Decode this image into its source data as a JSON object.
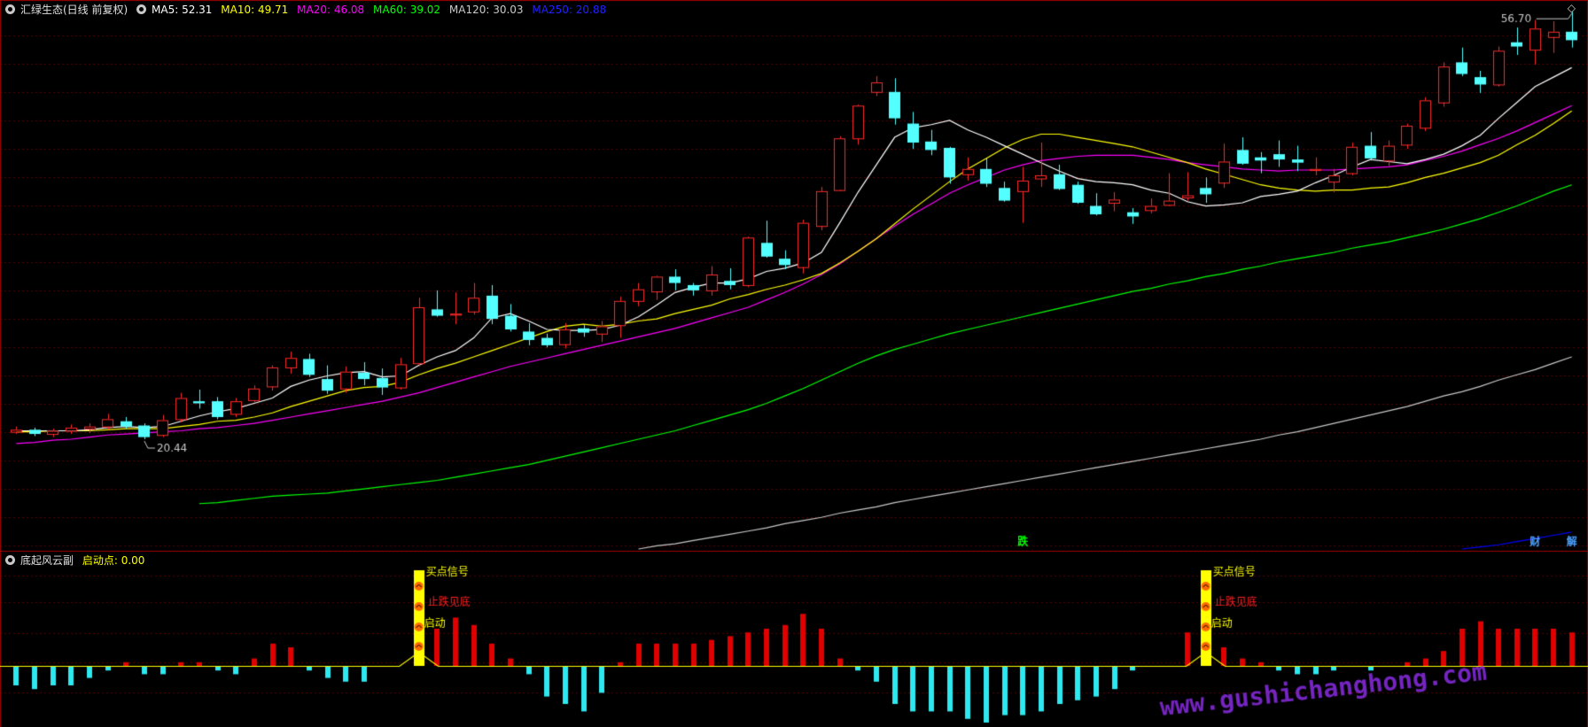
{
  "main_legend": {
    "title": "汇绿生态(日线 前复权)",
    "ma": [
      {
        "label": "MA5: 52.31",
        "color": "#ffffff"
      },
      {
        "label": "MA10: 49.71",
        "color": "#ffff00"
      },
      {
        "label": "MA20: 46.08",
        "color": "#ff00ff"
      },
      {
        "label": "MA60: 39.02",
        "color": "#00ff00"
      },
      {
        "label": "MA120: 30.03",
        "color": "#c8c8c8"
      },
      {
        "label": "MA250: 20.88",
        "color": "#0000ff"
      }
    ]
  },
  "sub_legend": {
    "title": "底起风云副",
    "value": "启动点: 0.00"
  },
  "annotations": {
    "high": "56.70",
    "low": "20.44",
    "markers": [
      "跌",
      "财",
      "解"
    ],
    "signal1": "买点信号",
    "signal2": "止跌见底",
    "signal3": "启动"
  },
  "watermark": "www.gushichanghong.com",
  "colors": {
    "up": "#ff2a2a",
    "down": "#54ffff",
    "grid": "#5a0000",
    "ma5": "#ffffff",
    "ma10": "#ffff00",
    "ma20": "#ff00ff",
    "ma60": "#00ff00",
    "ma120": "#c8c8c8",
    "ma250": "#0000ff",
    "signal": "#ffff00",
    "watermark": "#8a2be2"
  },
  "chart_data": {
    "type": "candlestick",
    "ohlc": [
      [
        21.1,
        21.6,
        20.9,
        21.3
      ],
      [
        21.3,
        21.5,
        20.7,
        20.9
      ],
      [
        20.9,
        21.4,
        20.6,
        21.2
      ],
      [
        21.2,
        21.8,
        20.9,
        21.5
      ],
      [
        21.4,
        21.9,
        21.0,
        21.6
      ],
      [
        21.6,
        22.8,
        21.3,
        22.3
      ],
      [
        22.1,
        22.5,
        21.4,
        21.6
      ],
      [
        21.7,
        21.9,
        20.4,
        20.6
      ],
      [
        20.8,
        22.7,
        20.6,
        22.2
      ],
      [
        22.3,
        24.8,
        22.0,
        24.3
      ],
      [
        24.0,
        25.1,
        23.3,
        23.8
      ],
      [
        24.0,
        24.4,
        22.3,
        22.5
      ],
      [
        22.8,
        24.3,
        22.5,
        24.0
      ],
      [
        24.1,
        25.5,
        23.9,
        25.2
      ],
      [
        25.4,
        27.4,
        25.0,
        27.2
      ],
      [
        27.2,
        28.7,
        26.6,
        28.1
      ],
      [
        28.0,
        28.5,
        26.3,
        26.5
      ],
      [
        26.1,
        27.4,
        24.7,
        25.0
      ],
      [
        25.2,
        27.3,
        24.8,
        26.8
      ],
      [
        26.7,
        27.7,
        25.5,
        26.1
      ],
      [
        26.2,
        27.1,
        24.6,
        25.3
      ],
      [
        25.3,
        28.1,
        25.1,
        27.5
      ],
      [
        27.6,
        33.8,
        27.3,
        32.9
      ],
      [
        32.7,
        34.5,
        32.0,
        32.1
      ],
      [
        32.2,
        34.3,
        31.3,
        32.3
      ],
      [
        32.5,
        35.2,
        32.2,
        33.8
      ],
      [
        34.0,
        35.0,
        31.3,
        31.8
      ],
      [
        32.1,
        33.2,
        30.6,
        30.8
      ],
      [
        30.6,
        31.4,
        29.3,
        29.8
      ],
      [
        30.0,
        30.4,
        29.1,
        29.3
      ],
      [
        29.4,
        31.4,
        29.0,
        30.8
      ],
      [
        30.9,
        31.3,
        30.1,
        30.5
      ],
      [
        30.4,
        31.6,
        29.6,
        31.1
      ],
      [
        31.2,
        33.9,
        30.0,
        33.5
      ],
      [
        33.5,
        35.2,
        33.0,
        34.6
      ],
      [
        34.4,
        35.9,
        33.6,
        35.8
      ],
      [
        35.8,
        36.5,
        34.5,
        35.2
      ],
      [
        35.0,
        35.2,
        34.0,
        34.5
      ],
      [
        34.5,
        36.8,
        34.0,
        36.0
      ],
      [
        35.4,
        36.6,
        34.6,
        35.0
      ],
      [
        35.0,
        39.6,
        34.8,
        39.5
      ],
      [
        39.0,
        41.1,
        37.6,
        37.7
      ],
      [
        37.5,
        38.3,
        36.5,
        36.9
      ],
      [
        36.7,
        41.2,
        36.1,
        40.9
      ],
      [
        40.6,
        44.3,
        40.2,
        43.9
      ],
      [
        44.0,
        49.1,
        43.9,
        48.9
      ],
      [
        48.9,
        52.1,
        48.3,
        52.0
      ],
      [
        53.3,
        54.8,
        52.9,
        54.2
      ],
      [
        53.3,
        54.6,
        50.2,
        50.8
      ],
      [
        50.3,
        51.4,
        47.9,
        48.5
      ],
      [
        48.6,
        49.7,
        47.3,
        47.8
      ],
      [
        48.0,
        48.1,
        44.6,
        45.2
      ],
      [
        45.5,
        47.1,
        44.9,
        46.0
      ],
      [
        46.0,
        47.0,
        44.3,
        44.6
      ],
      [
        44.2,
        44.8,
        42.9,
        43.0
      ],
      [
        43.9,
        46.2,
        40.9,
        44.9
      ],
      [
        45.1,
        48.5,
        44.3,
        45.4
      ],
      [
        45.5,
        46.4,
        44.0,
        44.1
      ],
      [
        44.5,
        44.8,
        42.7,
        42.8
      ],
      [
        42.5,
        43.7,
        41.6,
        41.7
      ],
      [
        42.8,
        43.8,
        42.0,
        43.1
      ],
      [
        41.9,
        42.3,
        40.8,
        41.5
      ],
      [
        42.1,
        43.2,
        41.8,
        42.5
      ],
      [
        42.6,
        45.6,
        42.5,
        43.0
      ],
      [
        43.3,
        45.7,
        43.0,
        43.5
      ],
      [
        44.2,
        45.2,
        42.8,
        43.6
      ],
      [
        44.7,
        48.4,
        44.2,
        46.7
      ],
      [
        47.8,
        49.0,
        46.4,
        46.5
      ],
      [
        47.1,
        47.6,
        45.6,
        46.8
      ],
      [
        47.4,
        48.7,
        46.2,
        46.9
      ],
      [
        46.9,
        48.2,
        45.8,
        46.6
      ],
      [
        45.9,
        47.1,
        45.4,
        46.0
      ],
      [
        44.8,
        46.0,
        43.8,
        45.4
      ],
      [
        45.6,
        48.5,
        45.4,
        48.1
      ],
      [
        48.2,
        49.5,
        46.8,
        47.0
      ],
      [
        46.8,
        48.7,
        46.3,
        48.2
      ],
      [
        48.3,
        50.3,
        47.9,
        50.1
      ],
      [
        49.9,
        52.8,
        49.6,
        52.5
      ],
      [
        52.3,
        56.1,
        51.9,
        55.7
      ],
      [
        56.1,
        57.5,
        54.8,
        55.0
      ],
      [
        54.7,
        55.3,
        53.2,
        54.0
      ],
      [
        54.0,
        57.6,
        53.8,
        57.2
      ],
      [
        58.0,
        59.4,
        56.8,
        57.6
      ],
      [
        57.3,
        60.1,
        55.9,
        59.3
      ],
      [
        58.5,
        60.0,
        57.0,
        59.0
      ],
      [
        59.0,
        60.9,
        57.5,
        58.2
      ]
    ],
    "ma5": [
      21.2,
      21.2,
      21.2,
      21.2,
      21.3,
      21.5,
      21.6,
      21.5,
      21.6,
      22.1,
      22.6,
      23.0,
      23.3,
      23.8,
      24.3,
      25.4,
      26.0,
      26.4,
      26.7,
      26.8,
      26.3,
      26.4,
      27.4,
      28.2,
      28.8,
      30.0,
      31.9,
      32.3,
      31.6,
      30.8,
      30.7,
      30.7,
      30.8,
      31.2,
      32.0,
      33.1,
      34.3,
      34.8,
      35.2,
      35.2,
      35.6,
      36.3,
      36.6,
      37.1,
      38.1,
      40.9,
      43.8,
      46.4,
      49.0,
      49.9,
      50.2,
      50.6,
      49.7,
      49.0,
      48.2,
      47.4,
      46.6,
      45.8,
      45.1,
      44.8,
      44.7,
      44.5,
      44.0,
      43.7,
      42.9,
      42.5,
      42.6,
      42.8,
      43.4,
      43.6,
      43.9,
      44.7,
      45.4,
      46.2,
      46.9,
      46.7,
      46.5,
      46.9,
      47.4,
      48.2,
      49.2,
      50.8,
      52.3,
      53.8,
      54.7,
      55.6
    ],
    "ma10": [
      21.1,
      21.1,
      21.2,
      21.2,
      21.2,
      21.3,
      21.4,
      21.4,
      21.4,
      21.6,
      21.8,
      22.1,
      22.2,
      22.5,
      22.9,
      23.5,
      24.0,
      24.5,
      25.0,
      25.3,
      25.4,
      25.8,
      26.5,
      27.1,
      27.6,
      28.2,
      28.8,
      29.4,
      30.0,
      30.6,
      31.1,
      31.3,
      31.1,
      31.3,
      31.6,
      31.8,
      32.3,
      32.7,
      33.1,
      33.7,
      34.1,
      34.6,
      35.0,
      35.5,
      36.1,
      37.1,
      38.2,
      39.4,
      40.8,
      42.2,
      43.5,
      44.8,
      46.0,
      47.0,
      48.0,
      48.8,
      49.3,
      49.3,
      49.0,
      48.7,
      48.4,
      48.1,
      47.6,
      47.1,
      46.6,
      46.0,
      45.5,
      45.0,
      44.5,
      44.2,
      44.0,
      43.9,
      44.0,
      44.0,
      44.2,
      44.3,
      44.7,
      45.2,
      45.6,
      46.1,
      46.6,
      47.3,
      48.3,
      49.2,
      50.3,
      51.5
    ],
    "ma20": [
      20.0,
      20.1,
      20.3,
      20.4,
      20.6,
      20.8,
      20.9,
      21.0,
      21.1,
      21.2,
      21.4,
      21.5,
      21.7,
      21.9,
      22.2,
      22.5,
      22.8,
      23.1,
      23.4,
      23.7,
      24.0,
      24.4,
      24.8,
      25.3,
      25.8,
      26.3,
      26.8,
      27.3,
      27.7,
      28.1,
      28.5,
      28.9,
      29.3,
      29.7,
      30.1,
      30.5,
      30.9,
      31.4,
      31.9,
      32.4,
      32.9,
      33.6,
      34.3,
      35.1,
      36.0,
      37.0,
      38.2,
      39.4,
      40.6,
      41.7,
      42.7,
      43.7,
      44.5,
      45.2,
      45.9,
      46.4,
      46.8,
      47.0,
      47.2,
      47.3,
      47.3,
      47.3,
      47.1,
      46.9,
      46.6,
      46.4,
      46.2,
      46.0,
      45.9,
      45.8,
      45.9,
      45.9,
      45.9,
      46.0,
      46.1,
      46.2,
      46.4,
      46.8,
      47.2,
      47.7,
      48.3,
      48.9,
      49.6,
      50.4,
      51.2,
      52.0
    ],
    "ma60": [
      null,
      null,
      null,
      null,
      null,
      null,
      null,
      null,
      null,
      null,
      14.3,
      14.4,
      14.6,
      14.8,
      15.0,
      15.1,
      15.2,
      15.3,
      15.5,
      15.7,
      15.9,
      16.1,
      16.3,
      16.5,
      16.8,
      17.1,
      17.4,
      17.7,
      18.0,
      18.4,
      18.8,
      19.2,
      19.6,
      20.0,
      20.4,
      20.8,
      21.2,
      21.7,
      22.2,
      22.7,
      23.2,
      23.8,
      24.5,
      25.2,
      26.0,
      26.8,
      27.6,
      28.3,
      28.9,
      29.4,
      29.9,
      30.4,
      30.8,
      31.2,
      31.6,
      32.0,
      32.4,
      32.8,
      33.2,
      33.6,
      34.0,
      34.4,
      34.7,
      35.1,
      35.4,
      35.8,
      36.1,
      36.5,
      36.8,
      37.2,
      37.5,
      37.8,
      38.1,
      38.5,
      38.8,
      39.1,
      39.5,
      39.9,
      40.3,
      40.8,
      41.3,
      41.9,
      42.5,
      43.2,
      43.9,
      44.5
    ],
    "ma120": [
      null,
      null,
      null,
      null,
      null,
      null,
      null,
      null,
      null,
      null,
      null,
      null,
      null,
      null,
      null,
      null,
      null,
      null,
      null,
      null,
      null,
      null,
      null,
      null,
      null,
      null,
      null,
      null,
      null,
      null,
      null,
      null,
      null,
      null,
      10.0,
      10.3,
      10.5,
      10.8,
      11.1,
      11.4,
      11.7,
      12.0,
      12.4,
      12.7,
      13.0,
      13.4,
      13.7,
      14.0,
      14.4,
      14.7,
      15.0,
      15.3,
      15.6,
      15.9,
      16.2,
      16.5,
      16.8,
      17.1,
      17.4,
      17.7,
      18.0,
      18.3,
      18.6,
      18.9,
      19.2,
      19.5,
      19.8,
      20.1,
      20.4,
      20.8,
      21.1,
      21.5,
      21.9,
      22.3,
      22.7,
      23.1,
      23.5,
      24.0,
      24.5,
      24.9,
      25.4,
      26.0,
      26.5,
      27.0,
      27.6,
      28.2
    ],
    "ma250": [
      null,
      null,
      null,
      null,
      null,
      null,
      null,
      null,
      null,
      null,
      null,
      null,
      null,
      null,
      null,
      null,
      null,
      null,
      null,
      null,
      null,
      null,
      null,
      null,
      null,
      null,
      null,
      null,
      null,
      null,
      null,
      null,
      null,
      null,
      null,
      null,
      null,
      null,
      null,
      null,
      null,
      null,
      null,
      null,
      null,
      null,
      null,
      null,
      null,
      null,
      null,
      null,
      null,
      null,
      null,
      null,
      null,
      null,
      null,
      null,
      null,
      null,
      null,
      null,
      null,
      null,
      null,
      null,
      null,
      null,
      null,
      null,
      null,
      null,
      null,
      null,
      null,
      null,
      null,
      10.0,
      10.2,
      10.4,
      10.7,
      11.0,
      11.3,
      11.6
    ],
    "indicator": [
      -5,
      -6,
      -5,
      -5,
      -3,
      -1,
      1,
      -2,
      -2,
      1,
      1,
      -1,
      -2,
      2,
      6,
      5,
      -1,
      -3,
      -4,
      -4,
      0,
      0,
      12,
      10,
      13,
      11,
      6,
      2,
      -2,
      -8,
      -10,
      -12,
      -7,
      1,
      6,
      6,
      6,
      6,
      7,
      8,
      9,
      10,
      11,
      14,
      10,
      2,
      -1,
      -4,
      -10,
      -12,
      -12,
      -12,
      -14,
      -15,
      -13,
      -13,
      -12,
      -10,
      -9,
      -8,
      -6,
      -1,
      0,
      0,
      9,
      7,
      5,
      2,
      1,
      -1,
      -2,
      -2,
      -1,
      0,
      -1,
      0,
      1,
      2,
      4,
      10,
      12,
      10,
      10,
      10,
      10,
      9
    ],
    "signals": [
      22,
      65
    ]
  }
}
